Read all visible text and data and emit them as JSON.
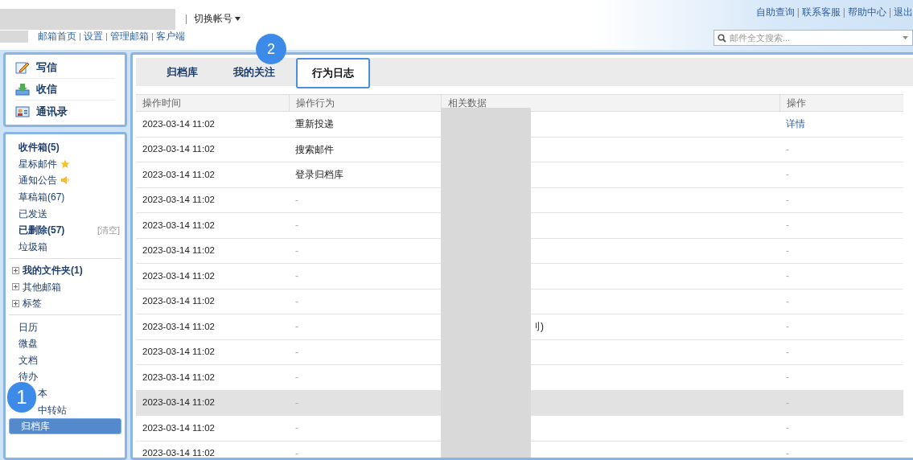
{
  "header": {
    "separator": "|",
    "switch_account": "切换帐号",
    "nav_links": [
      "邮箱首页",
      "设置",
      "管理邮箱",
      "客户端"
    ],
    "top_links": [
      "自助查询",
      "联系客服",
      "帮助中心",
      "退出"
    ],
    "search": {
      "placeholder": "邮件全文搜索..."
    }
  },
  "quick_actions": [
    {
      "kind": "compose",
      "label": "写信"
    },
    {
      "kind": "receive",
      "label": "收信"
    },
    {
      "kind": "contacts",
      "label": "通讯录"
    }
  ],
  "folders": [
    {
      "label": "收件箱(5)",
      "bold": true
    },
    {
      "label": "星标邮件",
      "bold": false,
      "kind": "starred"
    },
    {
      "label": "通知公告",
      "bold": false,
      "kind": "notice"
    },
    {
      "label": "草稿箱(67)",
      "bold": false
    },
    {
      "label": "已发送",
      "bold": false
    },
    {
      "label": "已删除(57)",
      "bold": true,
      "action": "[清空]"
    },
    {
      "label": "垃圾箱",
      "bold": false
    }
  ],
  "groups": [
    {
      "label": "我的文件夹(1)",
      "bold": true,
      "expanded": false
    },
    {
      "label": "其他邮箱",
      "bold": false,
      "expanded": false
    },
    {
      "label": "标签",
      "bold": false,
      "expanded": false
    }
  ],
  "apps": [
    {
      "label": "日历",
      "selected": false,
      "covered": false
    },
    {
      "label": "微盘",
      "selected": false,
      "covered": false
    },
    {
      "label": "文档",
      "selected": false,
      "covered": false
    },
    {
      "label": "待办",
      "selected": false,
      "covered": false
    },
    {
      "label": "本",
      "selected": false,
      "covered": true
    },
    {
      "label": "中转站",
      "selected": false,
      "covered": true
    },
    {
      "label": "归档库",
      "selected": true,
      "covered": false
    }
  ],
  "tabs": [
    {
      "label": "归档库",
      "selected": false
    },
    {
      "label": "我的关注",
      "selected": false
    },
    {
      "label": "行为日志",
      "selected": true
    }
  ],
  "callouts": [
    "1",
    "2"
  ],
  "table": {
    "columns": [
      "操作时间",
      "操作行为",
      "相关数据",
      "操作"
    ],
    "rows": [
      {
        "time": "2023-03-14 11:02",
        "action": "重新投递",
        "data": "",
        "op": "详情",
        "selected": false
      },
      {
        "time": "2023-03-14 11:02",
        "action": "搜索邮件",
        "data": "",
        "op": "-",
        "selected": false
      },
      {
        "time": "2023-03-14 11:02",
        "action": "登录归档库",
        "data": "",
        "op": "-",
        "selected": false
      },
      {
        "time": "2023-03-14 11:02",
        "action": "-",
        "data": "",
        "op": "-",
        "selected": false
      },
      {
        "time": "2023-03-14 11:02",
        "action": "-",
        "data": "",
        "op": "-",
        "selected": false
      },
      {
        "time": "2023-03-14 11:02",
        "action": "-",
        "data": "",
        "op": "-",
        "selected": false
      },
      {
        "time": "2023-03-14 11:02",
        "action": "-",
        "data": "",
        "op": "-",
        "selected": false
      },
      {
        "time": "2023-03-14 11:02",
        "action": "-",
        "data": "",
        "op": "-",
        "selected": false
      },
      {
        "time": "2023-03-14 11:02",
        "action": "-",
        "data": "刂)",
        "op": "-",
        "selected": false
      },
      {
        "time": "2023-03-14 11:02",
        "action": "-",
        "data": "",
        "op": "-",
        "selected": false
      },
      {
        "time": "2023-03-14 11:02",
        "action": "-",
        "data": "",
        "op": "-",
        "selected": false
      },
      {
        "time": "2023-03-14 11:02",
        "action": "-",
        "data": "",
        "op": "-",
        "selected": true
      },
      {
        "time": "2023-03-14 11:02",
        "action": "-",
        "data": "",
        "op": "-",
        "selected": false
      },
      {
        "time": "2023-03-14 11:02",
        "action": "-",
        "data": "",
        "op": "-",
        "selected": false
      }
    ]
  }
}
